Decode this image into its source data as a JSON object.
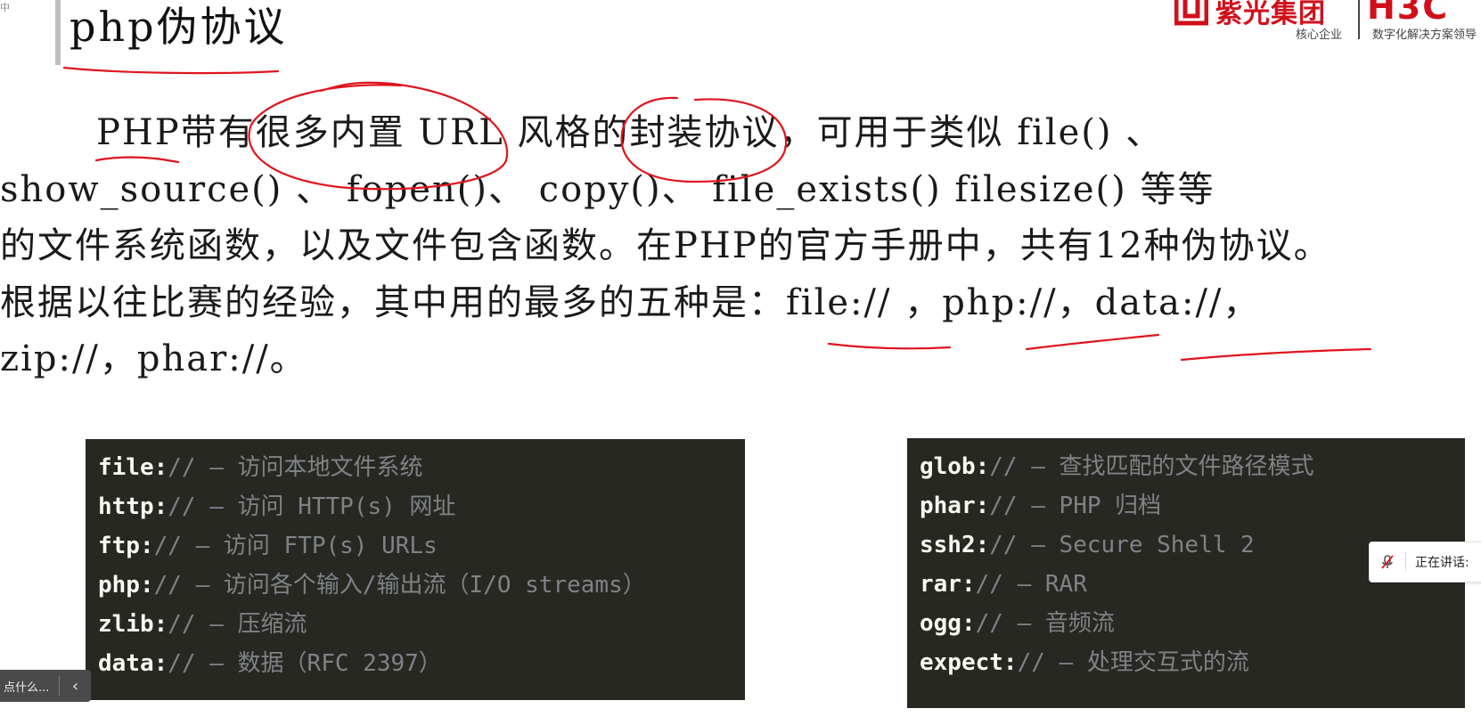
{
  "corner_text": "中",
  "title": "php伪协议",
  "logo": {
    "brand": "紫光集团",
    "tagline": "核心企业",
    "brand2": "H3C",
    "tagline2": "数字化解决方案领导"
  },
  "paragraph": {
    "lines": [
      "PHP带有很多内置 URL 风格的封装协议，可用于类似 file() 、",
      "show_source() 、 fopen()、 copy()、 file_exists()  filesize() 等等",
      "的文件系统函数，以及文件包含函数。在PHP的官方手册中，共有12种伪协议。",
      "根据以往比赛的经验，其中用的最多的五种是：file:// ，php://，data://，",
      "zip://，phar://。"
    ]
  },
  "left_box": [
    {
      "scheme": "file:",
      "rest": "// – 访问本地文件系统"
    },
    {
      "scheme": "http:",
      "rest": "// – 访问 HTTP(s) 网址"
    },
    {
      "scheme": "ftp:",
      "rest": "// – 访问 FTP(s) URLs"
    },
    {
      "scheme": "php:",
      "rest": "// – 访问各个输入/输出流（I/O streams）"
    },
    {
      "scheme": "zlib:",
      "rest": "// – 压缩流"
    },
    {
      "scheme": "data:",
      "rest": "// – 数据（RFC 2397）"
    }
  ],
  "right_box": [
    {
      "scheme": "glob:",
      "rest": "// – 查找匹配的文件路径模式"
    },
    {
      "scheme": "phar:",
      "rest": "// – PHP 归档"
    },
    {
      "scheme": "ssh2:",
      "rest": "// – Secure Shell 2"
    },
    {
      "scheme": "rar:",
      "rest": "// – RAR"
    },
    {
      "scheme": "ogg:",
      "rest": "// – 音频流"
    },
    {
      "scheme": "expect:",
      "rest": "// – 处理交互式的流"
    }
  ],
  "toast": {
    "text": "点什么...",
    "collapse_icon": "chevron-left-icon"
  },
  "speaking_indicator": {
    "label": "正在讲话:",
    "icon": "mic-muted-icon"
  },
  "colors": {
    "accent_red": "#d0101b",
    "annotation_red": "#e0141e",
    "code_bg": "#272822"
  }
}
